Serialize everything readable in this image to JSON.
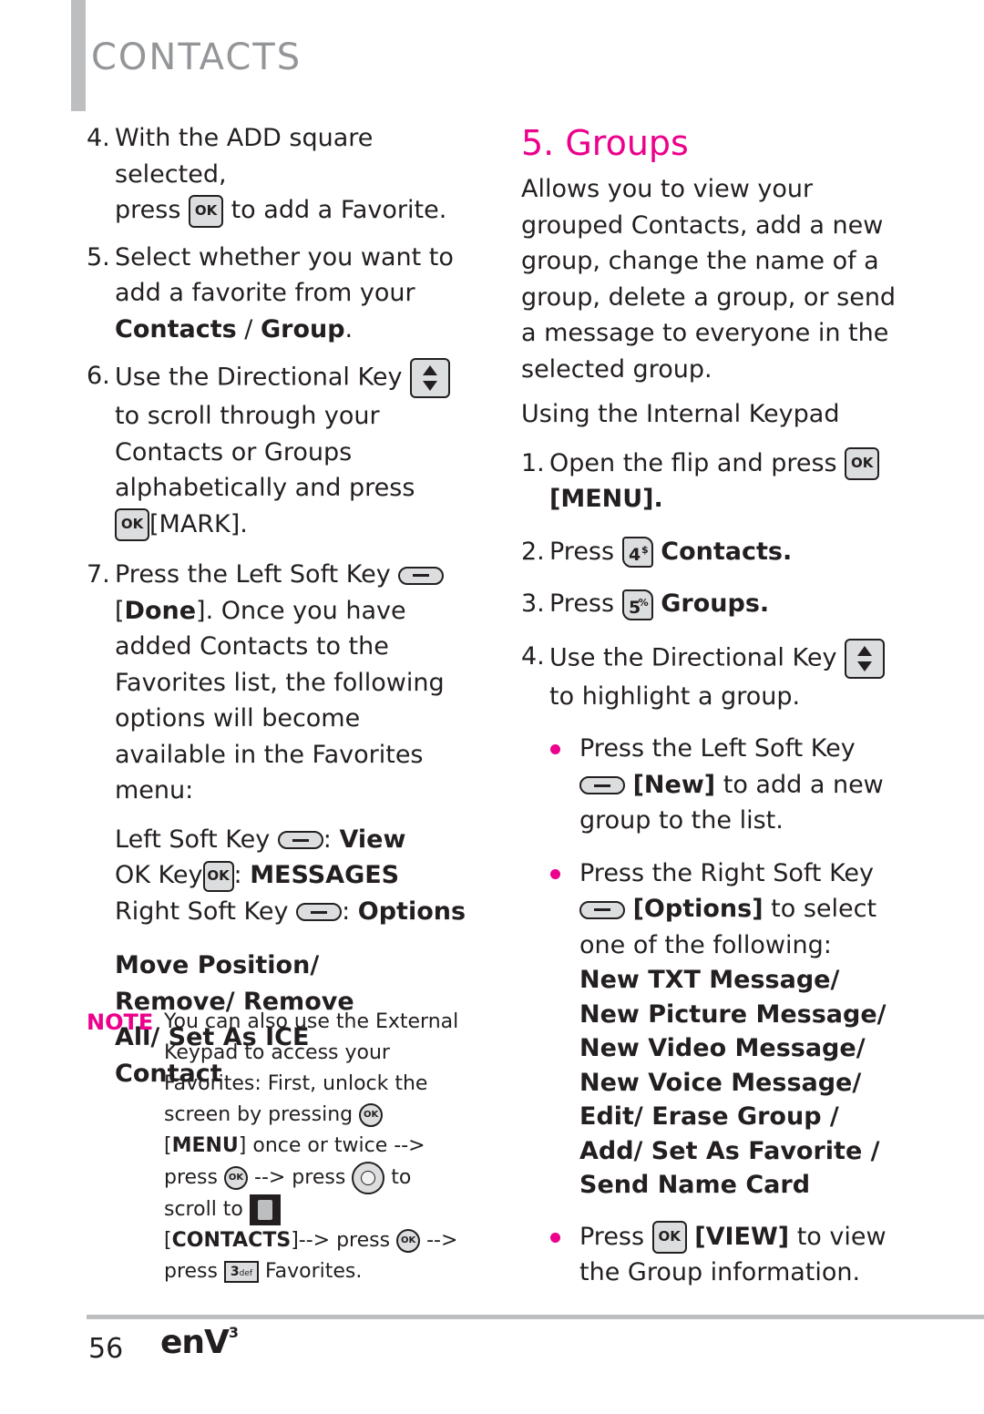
{
  "header": {
    "section_title": "CONTACTS"
  },
  "left_column": {
    "step4": {
      "num": "4.",
      "line1": "With the ADD square selected,",
      "press": "press",
      "key": "OK",
      "rest": "to add a Favorite."
    },
    "step5": {
      "num": "5.",
      "text": "Select whether you want to add a favorite from your",
      "bold1": "Contacts",
      "sep": " / ",
      "bold2": "Group",
      "end": "."
    },
    "step6": {
      "num": "6.",
      "text1": "Use the Directional Key",
      "text2": "to scroll through your Contacts or Groups alphabetically and press",
      "key": "OK",
      "action": "[MARK]."
    },
    "step7": {
      "num": "7.",
      "text1": "Press the Left Soft Key",
      "bracket_open": "[",
      "bold": "Done",
      "text2": "]. Once you have added Contacts to the Favorites list, the following options will become available in the Favorites menu:"
    },
    "soft_keys": [
      {
        "label": "Left Soft Key",
        "key": "left-soft-key",
        "value": "View"
      },
      {
        "label": "OK Key",
        "key": "OK",
        "value": "MESSAGES"
      },
      {
        "label": "Right Soft Key",
        "key": "right-soft-key",
        "value": "Options"
      }
    ],
    "options_line": "Move Position/ Remove/ Remove All/ Set As ICE Contact"
  },
  "note": {
    "label": "NOTE",
    "t1": "You can also use the External Keypad to access your Favorites: First, unlock the screen by pressing",
    "ok": "OK",
    "menu": "MENU",
    "t2": "once or twice --> press",
    "t3": "--> press",
    "t4": "to scroll to",
    "contacts": "CONTACTS",
    "t5": "--> press",
    "t6": "--> press",
    "key3": "3",
    "key3_sub": "def",
    "t7": "Favorites."
  },
  "right_column": {
    "title": "5. Groups",
    "intro": "Allows you to view your grouped Contacts, add a new group, change the name of a group, delete a group, or send a message to everyone in the selected group.",
    "subhead": "Using the Internal Keypad",
    "steps": [
      {
        "num": "1.",
        "text": "Open the flip and press",
        "key": "OK",
        "action": "[MENU]."
      },
      {
        "num": "2.",
        "text": "Press",
        "key": "4",
        "key_sup": "$",
        "action": "Contacts."
      },
      {
        "num": "3.",
        "text": "Press",
        "key": "5",
        "key_sup": "%",
        "action": "Groups."
      },
      {
        "num": "4.",
        "text1": "Use the Directional Key",
        "text2": "to highlight a group."
      }
    ],
    "bullets": [
      {
        "text1": "Press the Left Soft Key",
        "bold": "[New]",
        "text2": "to add a new group to the list."
      },
      {
        "text1": "Press the Right Soft Key",
        "bold": "[Options]",
        "text2": "to select one of the following:",
        "options": "New TXT Message/ New Picture Message/ New Video Message/ New Voice Message/ Edit/ Erase Group / Add/ Set As Favorite / Send Name Card"
      },
      {
        "text1": "Press",
        "key": "OK",
        "bold": "[VIEW]",
        "text2": "to view the Group information."
      }
    ]
  },
  "footer": {
    "page_number": "56",
    "brand": "enV",
    "brand_sup": "3"
  },
  "colors": {
    "accent_pink": "#ec008c",
    "header_gray": "#939598",
    "bar_gray": "#bcbec0",
    "text": "#231f20"
  }
}
